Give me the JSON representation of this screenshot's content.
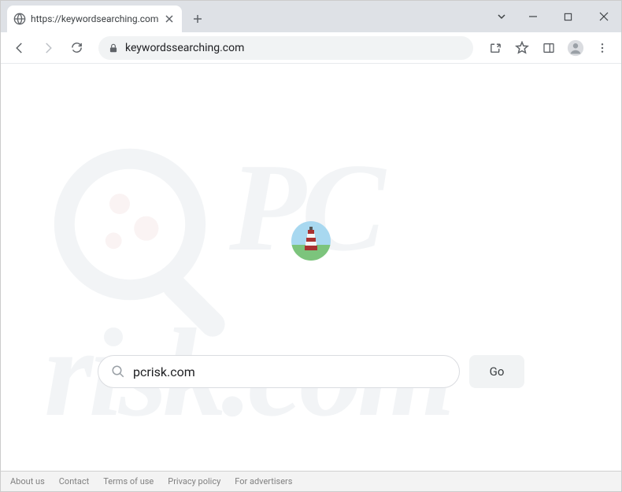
{
  "browser": {
    "tab_title": "https://keywordsearching.com",
    "url_display": "keywordssearching.com"
  },
  "search": {
    "value": "pcrisk.com",
    "go_label": "Go"
  },
  "watermark": {
    "top": "PC",
    "bottom": "risk.com"
  },
  "footer": {
    "links": [
      "About us",
      "Contact",
      "Terms of use",
      "Privacy policy",
      "For advertisers"
    ]
  }
}
